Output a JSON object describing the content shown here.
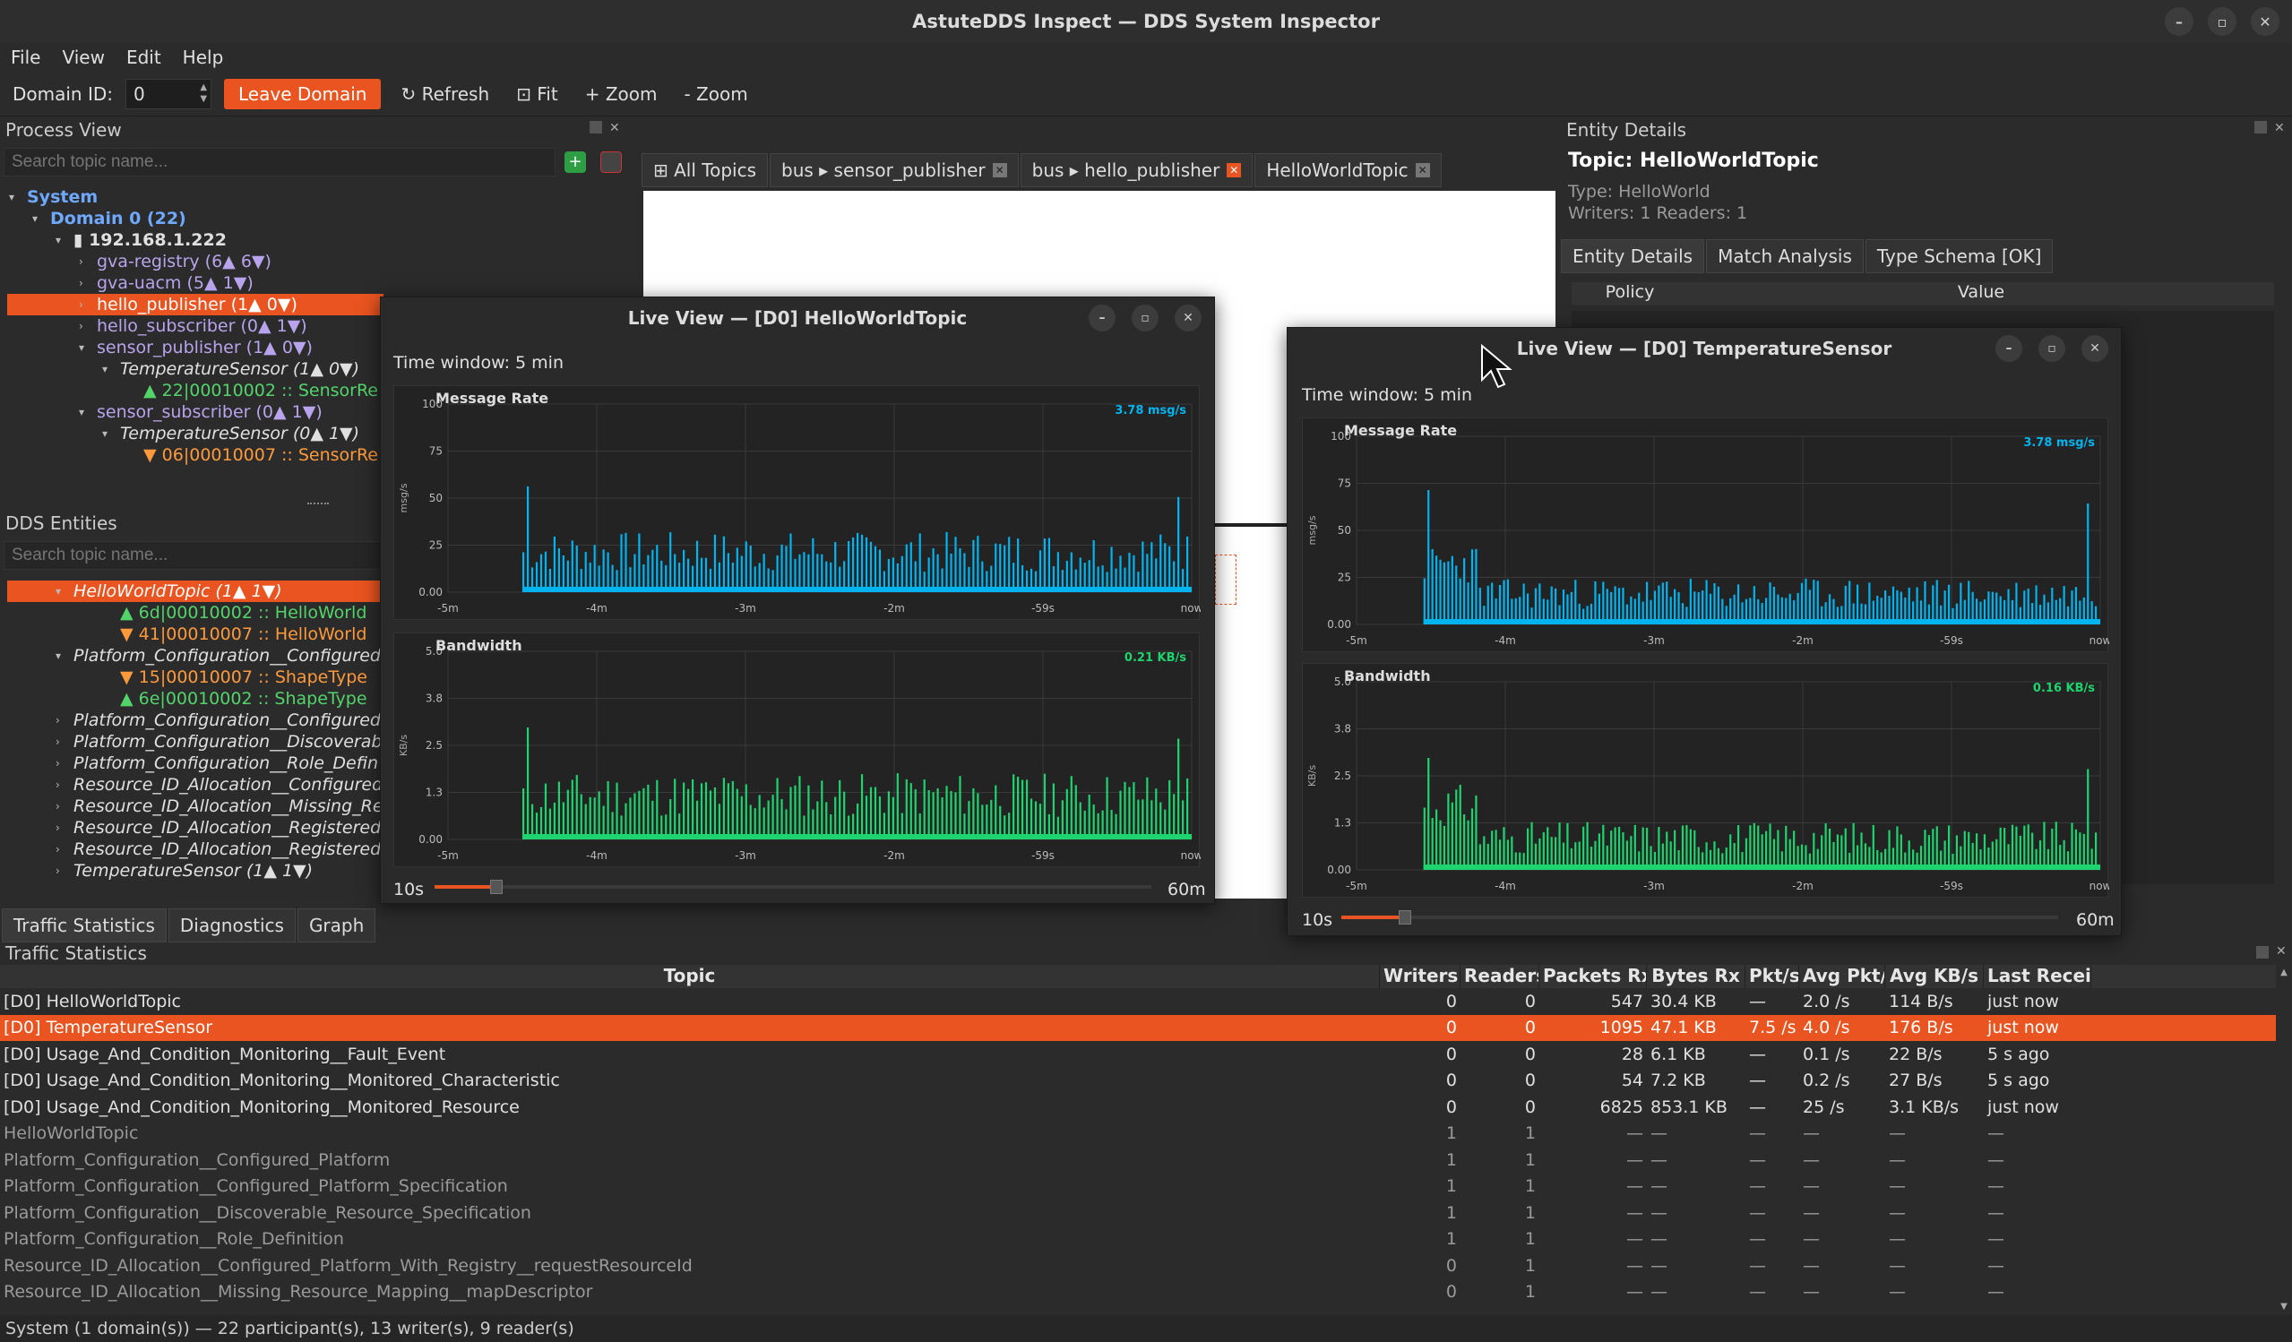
{
  "app": {
    "title": "AstuteDDS Inspect — DDS System Inspector"
  },
  "menu": {
    "items": [
      "File",
      "View",
      "Edit",
      "Help"
    ]
  },
  "toolbar": {
    "domain_label": "Domain ID:",
    "domain_value": "0",
    "leave": "Leave Domain",
    "refresh": "↻ Refresh",
    "fit": "⊡ Fit",
    "zoom_in": "+ Zoom",
    "zoom_out": "- Zoom"
  },
  "process_view": {
    "title": "Process View",
    "search_placeholder": "Search topic name...",
    "tree": [
      {
        "text": "System",
        "cls": "blue",
        "indent": 0,
        "caret": "▾"
      },
      {
        "text": "Domain 0  (22)",
        "cls": "blue",
        "indent": 1,
        "caret": "▾"
      },
      {
        "text": "▮ 192.168.1.222",
        "cls": "bold",
        "indent": 2,
        "caret": "▾"
      },
      {
        "text": "gva-registry  (6▲ 6▼)",
        "cls": "purple",
        "indent": 3,
        "caret": "›"
      },
      {
        "text": "gva-uacm  (5▲ 1▼)",
        "cls": "purple",
        "indent": 3,
        "caret": "›"
      },
      {
        "text": "hello_publisher  (1▲ 0▼)",
        "cls": "sel",
        "indent": 3,
        "caret": "›"
      },
      {
        "text": "hello_subscriber  (0▲ 1▼)",
        "cls": "purple",
        "indent": 3,
        "caret": "›"
      },
      {
        "text": "sensor_publisher  (1▲ 0▼)",
        "cls": "purple",
        "indent": 3,
        "caret": "▾"
      },
      {
        "text": "TemperatureSensor  (1▲ 0▼)",
        "cls": "ital",
        "indent": 4,
        "caret": "▾"
      },
      {
        "text": "▲ 22|00010002  :: SensorRe",
        "cls": "green",
        "indent": 5,
        "caret": ""
      },
      {
        "text": "sensor_subscriber  (0▲ 1▼)",
        "cls": "purple",
        "indent": 3,
        "caret": "▾"
      },
      {
        "text": "TemperatureSensor  (0▲ 1▼)",
        "cls": "ital",
        "indent": 4,
        "caret": "▾"
      },
      {
        "text": "▼ 06|00010007  :: SensorRe",
        "cls": "orange",
        "indent": 5,
        "caret": ""
      }
    ]
  },
  "dds_entities": {
    "title": "DDS Entities",
    "search_placeholder": "Search topic name...",
    "tree": [
      {
        "text": "HelloWorldTopic  (1▲ 1▼)",
        "cls": "sel ital",
        "indent": 2,
        "caret": "▾"
      },
      {
        "text": "▲ 6d|00010002  :: HelloWorld",
        "cls": "green",
        "indent": 4,
        "caret": ""
      },
      {
        "text": "▼ 41|00010007  :: HelloWorld",
        "cls": "orange",
        "indent": 4,
        "caret": ""
      },
      {
        "text": "Platform_Configuration__Configured_",
        "cls": "ital",
        "indent": 2,
        "caret": "▾"
      },
      {
        "text": "▼ 15|00010007  :: ShapeType",
        "cls": "orange",
        "indent": 4,
        "caret": ""
      },
      {
        "text": "▲ 6e|00010002  :: ShapeType",
        "cls": "green",
        "indent": 4,
        "caret": ""
      },
      {
        "text": "Platform_Configuration__Configured_",
        "cls": "ital",
        "indent": 2,
        "caret": "›"
      },
      {
        "text": "Platform_Configuration__Discoverab",
        "cls": "ital",
        "indent": 2,
        "caret": "›"
      },
      {
        "text": "Platform_Configuration__Role_Defin",
        "cls": "ital",
        "indent": 2,
        "caret": "›"
      },
      {
        "text": "Resource_ID_Allocation__Configured_",
        "cls": "ital",
        "indent": 2,
        "caret": "›"
      },
      {
        "text": "Resource_ID_Allocation__Missing_Re",
        "cls": "ital",
        "indent": 2,
        "caret": "›"
      },
      {
        "text": "Resource_ID_Allocation__Registered_",
        "cls": "ital",
        "indent": 2,
        "caret": "›"
      },
      {
        "text": "Resource_ID_Allocation__Registered_",
        "cls": "ital",
        "indent": 2,
        "caret": "›"
      },
      {
        "text": "TemperatureSensor  (1▲ 1▼)",
        "cls": "ital",
        "indent": 2,
        "caret": "›"
      }
    ]
  },
  "center_tabs": [
    {
      "label": "⊞ All Topics",
      "close": false
    },
    {
      "label": "bus ▸ sensor_publisher",
      "close": true,
      "red": false
    },
    {
      "label": "bus ▸ hello_publisher",
      "close": true,
      "red": true
    },
    {
      "label": "HelloWorldTopic",
      "close": true,
      "red": false
    }
  ],
  "entity_details": {
    "title": "Entity Details",
    "topic": "Topic: HelloWorldTopic",
    "type": "Type: HelloWorld",
    "counts": "Writers: 1  Readers: 1",
    "tabs": [
      "Entity Details",
      "Match Analysis",
      "Type Schema [OK]"
    ],
    "col_policy": "Policy",
    "col_value": "Value"
  },
  "live1": {
    "title": "Live View  —  [D0] HelloWorldTopic",
    "window": "Time window: 5 min",
    "slider_min": "10s",
    "slider_max": "60m",
    "rate": {
      "title": "Message Rate",
      "value": "3.78 msg/s",
      "unit": "msg/s",
      "yticks": [
        "100",
        "75",
        "50",
        "25",
        "0.00"
      ]
    },
    "bw": {
      "title": "Bandwidth",
      "value": "0.21 KB/s",
      "unit": "KB/s",
      "yticks": [
        "5.0",
        "3.8",
        "2.5",
        "1.3",
        "0.00"
      ]
    },
    "xticks": [
      "-5m",
      "-4m",
      "-3m",
      "-2m",
      "-59s",
      "now"
    ]
  },
  "live2": {
    "title": "Live View  —  [D0] TemperatureSensor",
    "window": "Time window: 5 min",
    "slider_min": "10s",
    "slider_max": "60m",
    "rate": {
      "title": "Message Rate",
      "value": "3.78 msg/s",
      "unit": "msg/s",
      "yticks": [
        "100",
        "75",
        "50",
        "25",
        "0.00"
      ]
    },
    "bw": {
      "title": "Bandwidth",
      "value": "0.16 KB/s",
      "unit": "KB/s",
      "yticks": [
        "5.0",
        "3.8",
        "2.5",
        "1.3",
        "0.00"
      ]
    },
    "xticks": [
      "-5m",
      "-4m",
      "-3m",
      "-2m",
      "-59s",
      "now"
    ]
  },
  "bottom_tabs": [
    "Traffic Statistics",
    "Diagnostics",
    "Graph"
  ],
  "traffic": {
    "title": "Traffic Statistics",
    "columns": [
      "Topic",
      "Writers",
      "Readers",
      "Packets Rx",
      "Bytes Rx",
      "Pkt/s",
      "Avg Pkt/s",
      "Avg KB/s",
      "Last Received"
    ],
    "rows": [
      {
        "cells": [
          "[D0] HelloWorldTopic",
          "0",
          "0",
          "547",
          "30.4 KB",
          "—",
          "2.0 /s",
          "114 B/s",
          "just now"
        ],
        "style": "live"
      },
      {
        "cells": [
          "[D0] TemperatureSensor",
          "0",
          "0",
          "1095",
          "47.1 KB",
          "7.5 /s",
          "4.0 /s",
          "176 B/s",
          "just now"
        ],
        "style": "sel"
      },
      {
        "cells": [
          "[D0] Usage_And_Condition_Monitoring__Fault_Event",
          "0",
          "0",
          "28",
          "6.1 KB",
          "—",
          "0.1 /s",
          "22 B/s",
          "5 s ago"
        ],
        "style": "live"
      },
      {
        "cells": [
          "[D0] Usage_And_Condition_Monitoring__Monitored_Characteristic",
          "0",
          "0",
          "54",
          "7.2 KB",
          "—",
          "0.2 /s",
          "27 B/s",
          "5 s ago"
        ],
        "style": "live"
      },
      {
        "cells": [
          "[D0] Usage_And_Condition_Monitoring__Monitored_Resource",
          "0",
          "0",
          "6825",
          "853.1 KB",
          "—",
          "25 /s",
          "3.1 KB/s",
          "just now"
        ],
        "style": "live"
      },
      {
        "cells": [
          "HelloWorldTopic",
          "1",
          "1",
          "—",
          "—",
          "—",
          "—",
          "—",
          "—"
        ],
        "style": "dim"
      },
      {
        "cells": [
          "Platform_Configuration__Configured_Platform",
          "1",
          "1",
          "—",
          "—",
          "—",
          "—",
          "—",
          "—"
        ],
        "style": "dim"
      },
      {
        "cells": [
          "Platform_Configuration__Configured_Platform_Specification",
          "1",
          "1",
          "—",
          "—",
          "—",
          "—",
          "—",
          "—"
        ],
        "style": "dim"
      },
      {
        "cells": [
          "Platform_Configuration__Discoverable_Resource_Specification",
          "1",
          "1",
          "—",
          "—",
          "—",
          "—",
          "—",
          "—"
        ],
        "style": "dim"
      },
      {
        "cells": [
          "Platform_Configuration__Role_Definition",
          "1",
          "1",
          "—",
          "—",
          "—",
          "—",
          "—",
          "—"
        ],
        "style": "dim"
      },
      {
        "cells": [
          "Resource_ID_Allocation__Configured_Platform_With_Registry__requestResourceId",
          "0",
          "1",
          "—",
          "—",
          "—",
          "—",
          "—",
          "—"
        ],
        "style": "dim"
      },
      {
        "cells": [
          "Resource_ID_Allocation__Missing_Resource_Mapping__mapDescriptor",
          "0",
          "1",
          "—",
          "—",
          "—",
          "—",
          "—",
          "—"
        ],
        "style": "dim"
      }
    ]
  },
  "status": {
    "text": "System (1 domain(s)) — 22 participant(s), 13 writer(s), 9 reader(s)"
  },
  "colors": {
    "accent": "#e95420",
    "rate": "#00b4f0",
    "bandwidth": "#1ed46e"
  }
}
